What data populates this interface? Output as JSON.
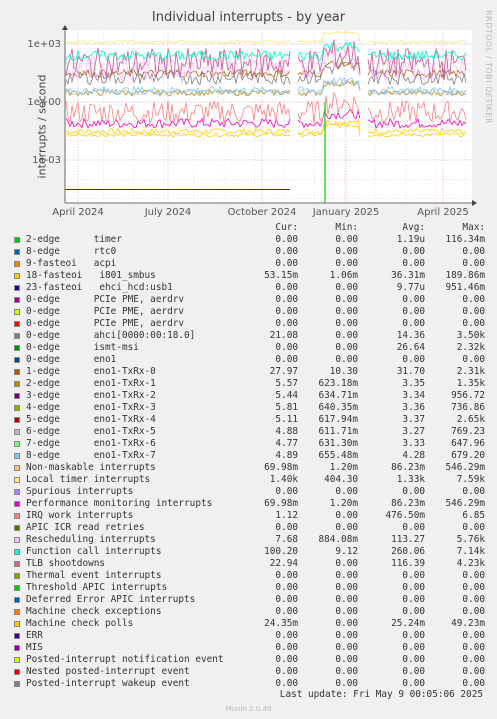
{
  "header": {
    "title": "Individual interrupts - by year",
    "y_axis_label": "interrupts / second",
    "side_label": "RRDTOOL / TOBI OETIKER"
  },
  "chart_data": {
    "type": "line",
    "title": "Individual interrupts - by year",
    "ylabel": "interrupts / second",
    "y_scale": "log",
    "y_ticks": [
      "1e+03",
      "1e+00",
      "1e-03"
    ],
    "x_ticks": [
      "April 2024",
      "July 2024",
      "October 2024",
      "January 2025",
      "April 2025"
    ],
    "grid": true,
    "series_colors": [
      "#00cc00",
      "#0066b3",
      "#ff8000",
      "#ffcc00",
      "#330099",
      "#990099",
      "#ccff00",
      "#ff0000",
      "#808080",
      "#008f00",
      "#00487d",
      "#b35a00",
      "#b38f00",
      "#6b006b",
      "#8fb300",
      "#b30000",
      "#bebebe",
      "#80ff80",
      "#80c9ff",
      "#ffc080",
      "#ffe680",
      "#aa80ff",
      "#ee00cc",
      "#ff8080",
      "#666600",
      "#ffbfff",
      "#00ffcc",
      "#cc6699",
      "#999900",
      "#00cc00",
      "#0066b3",
      "#ff8000",
      "#ffcc00",
      "#330099",
      "#990099",
      "#ccff00",
      "#ff0000",
      "#808080"
    ]
  },
  "legend": {
    "headers": {
      "cur": "Cur:",
      "min": "Min:",
      "avg": "Avg:",
      "max": "Max:"
    },
    "rows": [
      {
        "label": "2-edge      timer",
        "cur": "0.00",
        "min": "0.00",
        "avg": "1.19u",
        "max": "116.34m"
      },
      {
        "label": "8-edge      rtc0",
        "cur": "0.00",
        "min": "0.00",
        "avg": "0.00",
        "max": "0.00"
      },
      {
        "label": "9-fasteoi   acpi",
        "cur": "0.00",
        "min": "0.00",
        "avg": "0.00",
        "max": "0.00"
      },
      {
        "label": "18-fasteoi   i801_smbus",
        "cur": "53.15m",
        "min": "1.06m",
        "avg": "36.31m",
        "max": "189.86m"
      },
      {
        "label": "23-fasteoi   ehci_hcd:usb1",
        "cur": "0.00",
        "min": "0.00",
        "avg": "9.77u",
        "max": "951.46m"
      },
      {
        "label": "0-edge      PCIe PME, aerdrv",
        "cur": "0.00",
        "min": "0.00",
        "avg": "0.00",
        "max": "0.00"
      },
      {
        "label": "0-edge      PCIe PME, aerdrv",
        "cur": "0.00",
        "min": "0.00",
        "avg": "0.00",
        "max": "0.00"
      },
      {
        "label": "0-edge      PCIe PME, aerdrv",
        "cur": "0.00",
        "min": "0.00",
        "avg": "0.00",
        "max": "0.00"
      },
      {
        "label": "0-edge      ahci[0000:00:18.0]",
        "cur": "21.08",
        "min": "0.00",
        "avg": "14.36",
        "max": "3.50k"
      },
      {
        "label": "0-edge      ismt-msi",
        "cur": "0.00",
        "min": "0.00",
        "avg": "26.64",
        "max": "2.32k"
      },
      {
        "label": "0-edge      eno1",
        "cur": "0.00",
        "min": "0.00",
        "avg": "0.00",
        "max": "0.00"
      },
      {
        "label": "1-edge      eno1-TxRx-0",
        "cur": "27.97",
        "min": "10.30",
        "avg": "31.70",
        "max": "2.31k"
      },
      {
        "label": "2-edge      eno1-TxRx-1",
        "cur": "5.57",
        "min": "623.18m",
        "avg": "3.35",
        "max": "1.35k"
      },
      {
        "label": "3-edge      eno1-TxRx-2",
        "cur": "5.44",
        "min": "634.71m",
        "avg": "3.34",
        "max": "956.72"
      },
      {
        "label": "4-edge      eno1-TxRx-3",
        "cur": "5.81",
        "min": "640.35m",
        "avg": "3.36",
        "max": "736.86"
      },
      {
        "label": "5-edge      eno1-TxRx-4",
        "cur": "5.11",
        "min": "617.94m",
        "avg": "3.37",
        "max": "2.65k"
      },
      {
        "label": "6-edge      eno1-TxRx-5",
        "cur": "4.88",
        "min": "611.71m",
        "avg": "3.27",
        "max": "769.23"
      },
      {
        "label": "7-edge      eno1-TxRx-6",
        "cur": "4.77",
        "min": "631.30m",
        "avg": "3.33",
        "max": "647.96"
      },
      {
        "label": "8-edge      eno1-TxRx-7",
        "cur": "4.89",
        "min": "655.48m",
        "avg": "4.28",
        "max": "679.20"
      },
      {
        "label": "Non-maskable interrupts",
        "cur": "69.98m",
        "min": "1.20m",
        "avg": "86.23m",
        "max": "546.29m"
      },
      {
        "label": "Local timer interrupts",
        "cur": "1.40k",
        "min": "404.30",
        "avg": "1.33k",
        "max": "7.59k"
      },
      {
        "label": "Spurious interrupts",
        "cur": "0.00",
        "min": "0.00",
        "avg": "0.00",
        "max": "0.00"
      },
      {
        "label": "Performance monitoring interrupts",
        "cur": "69.98m",
        "min": "1.20m",
        "avg": "86.23m",
        "max": "546.29m"
      },
      {
        "label": "IRQ work interrupts",
        "cur": "1.12",
        "min": "0.00",
        "avg": "476.50m",
        "max": "6.85"
      },
      {
        "label": "APIC ICR read retries",
        "cur": "0.00",
        "min": "0.00",
        "avg": "0.00",
        "max": "0.00"
      },
      {
        "label": "Rescheduling interrupts",
        "cur": "7.68",
        "min": "884.08m",
        "avg": "113.27",
        "max": "5.76k"
      },
      {
        "label": "Function call interrupts",
        "cur": "100.20",
        "min": "9.12",
        "avg": "260.06",
        "max": "7.14k"
      },
      {
        "label": "TLB shootdowns",
        "cur": "22.94",
        "min": "0.00",
        "avg": "116.39",
        "max": "4.23k"
      },
      {
        "label": "Thermal event interrupts",
        "cur": "0.00",
        "min": "0.00",
        "avg": "0.00",
        "max": "0.00"
      },
      {
        "label": "Threshold APIC interrupts",
        "cur": "0.00",
        "min": "0.00",
        "avg": "0.00",
        "max": "0.00"
      },
      {
        "label": "Deferred Error APIC interrupts",
        "cur": "0.00",
        "min": "0.00",
        "avg": "0.00",
        "max": "0.00"
      },
      {
        "label": "Machine check exceptions",
        "cur": "0.00",
        "min": "0.00",
        "avg": "0.00",
        "max": "0.00"
      },
      {
        "label": "Machine check polls",
        "cur": "24.35m",
        "min": "0.00",
        "avg": "25.24m",
        "max": "49.23m"
      },
      {
        "label": "ERR",
        "cur": "0.00",
        "min": "0.00",
        "avg": "0.00",
        "max": "0.00"
      },
      {
        "label": "MIS",
        "cur": "0.00",
        "min": "0.00",
        "avg": "0.00",
        "max": "0.00"
      },
      {
        "label": "Posted-interrupt notification event",
        "cur": "0.00",
        "min": "0.00",
        "avg": "0.00",
        "max": "0.00"
      },
      {
        "label": "Nested posted-interrupt event",
        "cur": "0.00",
        "min": "0.00",
        "avg": "0.00",
        "max": "0.00"
      },
      {
        "label": "Posted-interrupt wakeup event",
        "cur": "0.00",
        "min": "0.00",
        "avg": "0.00",
        "max": "0.00"
      }
    ]
  },
  "footer": {
    "last_update": "Last update: Fri May  9 00:05:06 2025",
    "generator": "Munin 2.0.49"
  }
}
